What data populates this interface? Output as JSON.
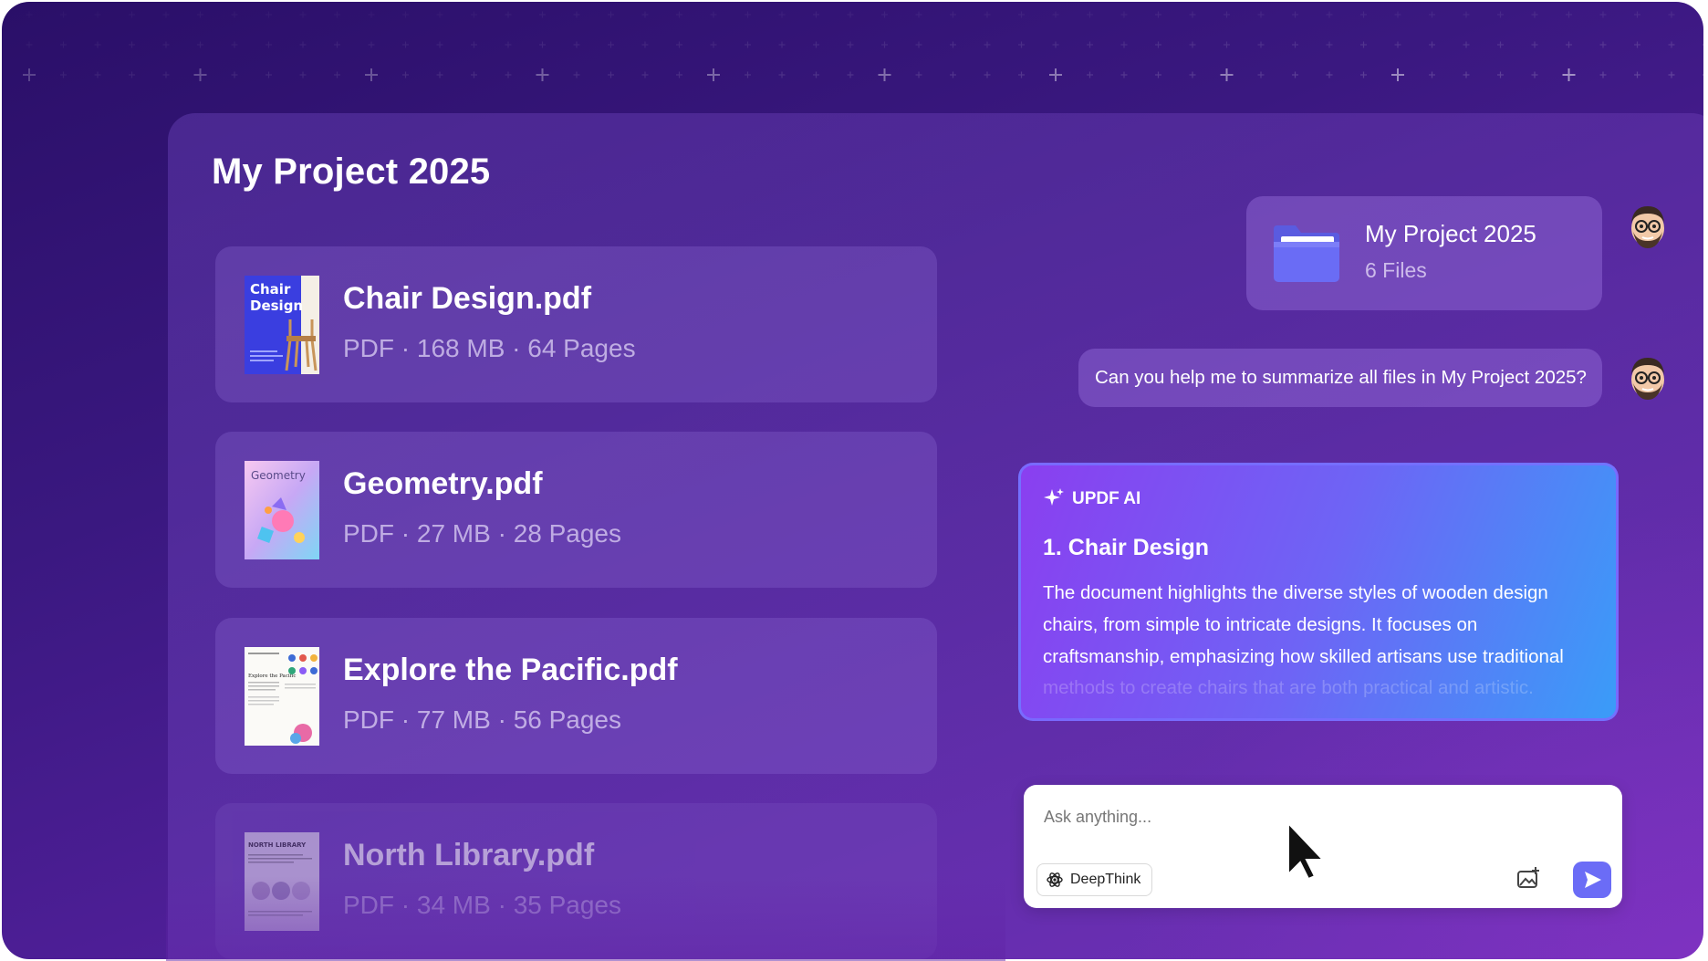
{
  "project": {
    "title": "My Project 2025"
  },
  "files": [
    {
      "name": "Chair Design.pdf",
      "meta": "PDF · 168 MB · 64 Pages",
      "thumb_text": "Chair\nDesign"
    },
    {
      "name": "Geometry.pdf",
      "meta": "PDF · 27 MB · 28 Pages",
      "thumb_text": "Geometry"
    },
    {
      "name": "Explore the Pacific.pdf",
      "meta": "PDF · 77 MB · 56 Pages",
      "thumb_text": "Explore the Pacific"
    },
    {
      "name": "North Library.pdf",
      "meta": "PDF · 34 MB · 35 Pages",
      "thumb_text": "NORTH LIBRARY"
    }
  ],
  "chat": {
    "folder": {
      "title": "My Project 2025",
      "count": "6 Files",
      "icon": "folder-icon"
    },
    "question": "Can you help me to summarize all files in My Project 2025?",
    "ai": {
      "label": "UPDF AI",
      "heading": "1. Chair Design",
      "lines": [
        "The document highlights the diverse styles of wooden design",
        "chairs, from simple to intricate designs. It focuses on",
        "craftsmanship, emphasizing how skilled artisans use traditional",
        "methods to create chairs that are both practical and artistic."
      ]
    }
  },
  "input": {
    "placeholder": "Ask anything...",
    "deepthink_label": "DeepThink",
    "image_icon": "image-icon",
    "send_icon": "send-icon"
  },
  "colors": {
    "background": "#3a1880",
    "ai_gradient_start": "#8a3ff0",
    "ai_gradient_end": "#3a9cf8",
    "send_button": "#6b6cf6"
  }
}
